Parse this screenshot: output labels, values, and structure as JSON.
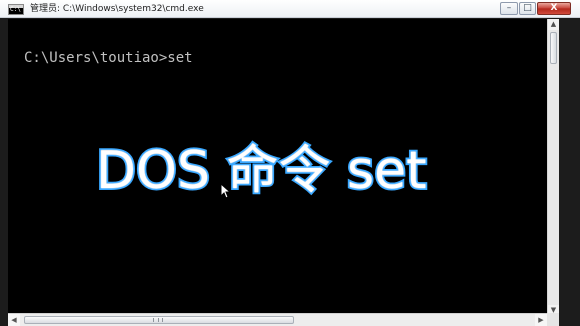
{
  "window": {
    "title": "管理员: C:\\Windows\\system32\\cmd.exe",
    "buttons": {
      "minimize": "–",
      "maximize": "□",
      "close": "X"
    }
  },
  "console": {
    "prompt_line": "C:\\Users\\toutiao>set"
  },
  "overlay": {
    "text": "DOS 命令 set"
  },
  "scrollbars": {
    "vertical": {
      "up": "▲",
      "down": "▼"
    },
    "horizontal": {
      "left": "◀",
      "right": "▶"
    }
  },
  "icons": {
    "app": "cmd-app-icon",
    "cursor": "mouse-pointer-icon"
  },
  "colors": {
    "console_background": "#000000",
    "console_text": "#c0c0c0",
    "overlay_stroke": "#38a7ff",
    "overlay_fill": "#ffffff",
    "close_button": "#c7443a"
  }
}
